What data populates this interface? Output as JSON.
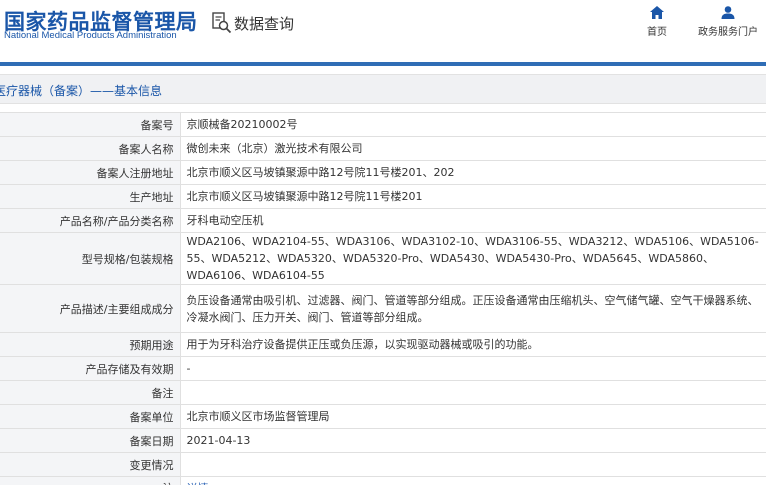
{
  "header": {
    "logo_cn": "国家药品监督管理局",
    "logo_en": "National Medical Products Administration",
    "query_title": "数据查询",
    "query_icon": "search-document-icon",
    "nav": [
      {
        "label": "首页",
        "icon": "home-icon"
      },
      {
        "label": "政务服务门户",
        "icon": "user-icon"
      }
    ]
  },
  "colors": {
    "brand": "#1a56a8",
    "accent_bar": "#2f6db5",
    "link": "#2a62b5"
  },
  "section": {
    "title": "医疗器械（备案）——基本信息"
  },
  "rows": [
    {
      "label": "备案号",
      "value": "京顺械备20210002号"
    },
    {
      "label": "备案人名称",
      "value": "微创未来（北京）激光技术有限公司"
    },
    {
      "label": "备案人注册地址",
      "value": "北京市顺义区马坡镇聚源中路12号院11号楼201、202"
    },
    {
      "label": "生产地址",
      "value": "北京市顺义区马坡镇聚源中路12号院11号楼201"
    },
    {
      "label": "产品名称/产品分类名称",
      "value": "牙科电动空压机"
    },
    {
      "label": "型号规格/包装规格",
      "value": "WDA2106、WDA2104-55、WDA3106、WDA3102-10、WDA3106-55、WDA3212、WDA5106、WDA5106-55、WDA5212、WDA5320、WDA5320-Pro、WDA5430、WDA5430-Pro、WDA5645、WDA5860、WDA6106、WDA6104-55"
    },
    {
      "label": "产品描述/主要组成成分",
      "value": "负压设备通常由吸引机、过滤器、阀门、管道等部分组成。正压设备通常由压缩机头、空气储气罐、空气干燥器系统、冷凝水阀门、压力开关、阀门、管道等部分组成。"
    },
    {
      "label": "预期用途",
      "value": "用于为牙科治疗设备提供正压或负压源，以实现驱动器械或吸引的功能。"
    },
    {
      "label": "产品存储及有效期",
      "value": "-"
    },
    {
      "label": "备注",
      "value": ""
    },
    {
      "label": "备案单位",
      "value": "北京市顺义区市场监督管理局"
    },
    {
      "label": "备案日期",
      "value": "2021-04-13"
    },
    {
      "label": "变更情况",
      "value": ""
    }
  ],
  "note_row": {
    "label": "注",
    "icon": "pin-icon",
    "link": "详情"
  }
}
